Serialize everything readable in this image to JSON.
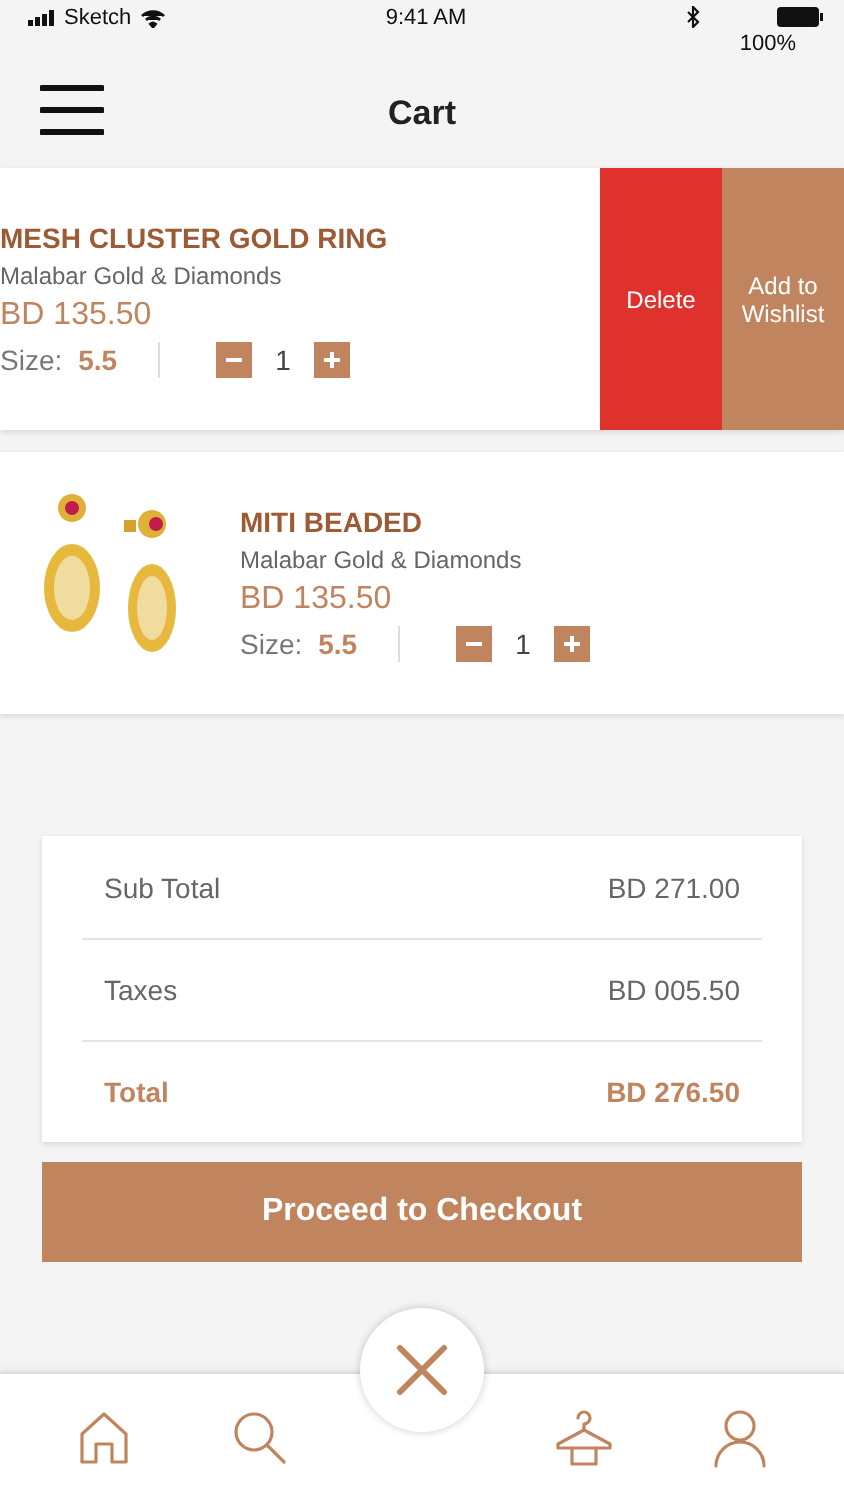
{
  "status_bar": {
    "carrier": "Sketch",
    "time": "9:41 AM",
    "battery": "100%"
  },
  "header": {
    "title": "Cart"
  },
  "items": [
    {
      "name": "MESH CLUSTER GOLD RING",
      "brand": "Malabar Gold & Diamonds",
      "price": "BD 135.50",
      "size_label": "Size:",
      "size": "5.5",
      "quantity": "1",
      "swiped": true,
      "actions": [
        "Delete",
        "Add to Wishlist"
      ]
    },
    {
      "name": "MITI BEADED",
      "brand": "Malabar Gold & Diamonds",
      "price": "BD 135.50",
      "size_label": "Size:",
      "size": "5.5",
      "quantity": "1",
      "swiped": false
    }
  ],
  "summary": [
    {
      "label": "Sub Total",
      "value": "BD 271.00",
      "kind": "line"
    },
    {
      "label": "Taxes",
      "value": "BD 005.50",
      "kind": "line"
    },
    {
      "label": "Total",
      "value": "BD 276.50",
      "kind": "total"
    }
  ],
  "checkout_button": "Proceed to Checkout"
}
